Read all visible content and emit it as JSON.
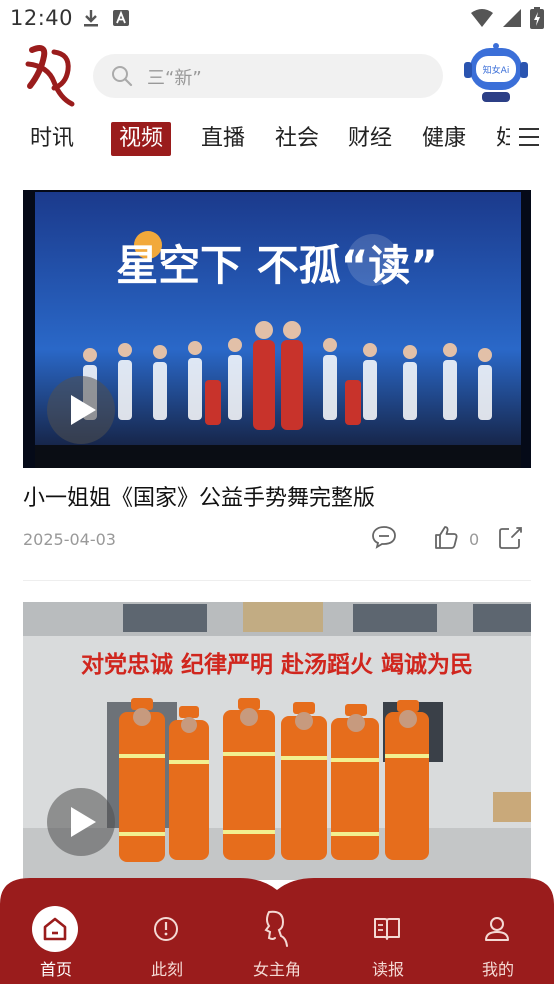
{
  "status_bar": {
    "time": "12:40"
  },
  "header": {
    "logo": "女",
    "search": {
      "placeholder": "三“新”"
    },
    "ai_button": {
      "label": "知女Ai"
    }
  },
  "tabs": [
    {
      "label": "时讯",
      "active": false
    },
    {
      "label": "视频",
      "active": true
    },
    {
      "label": "直播",
      "active": false
    },
    {
      "label": "社会",
      "active": false
    },
    {
      "label": "财经",
      "active": false
    },
    {
      "label": "健康",
      "active": false
    },
    {
      "label": "妇",
      "active": false
    }
  ],
  "videos": [
    {
      "title": "小一姐姐《国家》公益手势舞完整版",
      "date": "2025-04-03",
      "likes": "0",
      "thumbnail_text": {
        "headline": "星空下 不孤“读”"
      }
    },
    {
      "title": "",
      "thumbnail_text": {
        "banner": "对党忠诚  纪律严明  赴汤蹈火  竭诚为民"
      }
    }
  ],
  "bottom_nav": [
    {
      "label": "首页",
      "icon": "home-icon",
      "active": true
    },
    {
      "label": "此刻",
      "icon": "clock-icon",
      "active": false
    },
    {
      "label": "女主角",
      "icon": "profile-silhouette-icon",
      "active": false
    },
    {
      "label": "读报",
      "icon": "book-icon",
      "active": false
    },
    {
      "label": "我的",
      "icon": "user-icon",
      "active": false
    }
  ],
  "colors": {
    "accent": "#9a1c1c",
    "nav_bg": "#9a1c1c"
  }
}
